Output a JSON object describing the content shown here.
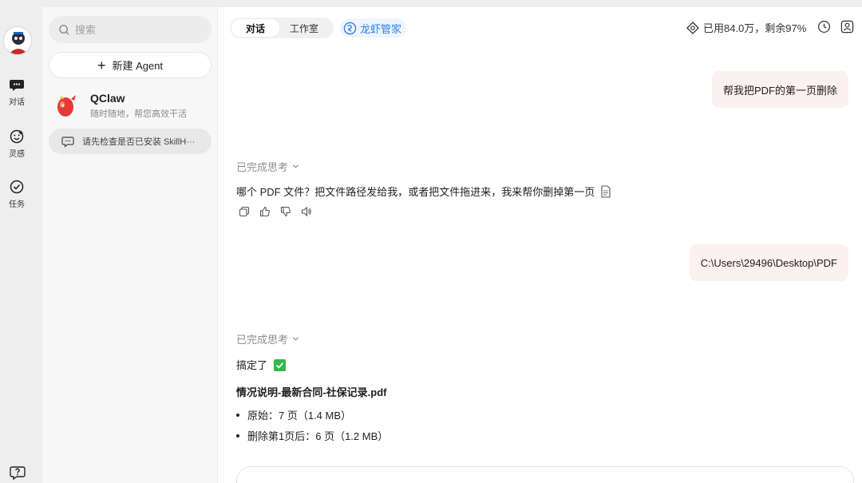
{
  "rail": {
    "items": [
      {
        "label": "对话",
        "icon": "chat-bubble-icon"
      },
      {
        "label": "灵感",
        "icon": "smiley-icon"
      },
      {
        "label": "任务",
        "icon": "check-circle-icon"
      }
    ],
    "help_icon": "help-icon"
  },
  "panel": {
    "search_placeholder": "搜索",
    "new_agent_label": "新建 Agent",
    "agent": {
      "name": "QClaw",
      "description": "随时随地，帮您高效干活"
    },
    "conversation": {
      "title": "请先检查是否已安装 SkillH···"
    }
  },
  "header": {
    "tabs": [
      {
        "label": "对话",
        "active": true
      },
      {
        "label": "工作室",
        "active": false
      }
    ],
    "brand_label": "龙虾管家",
    "quota_text": "已用84.0万，剩余97%"
  },
  "messages": {
    "user1": "帮我把PDF的第一页删除",
    "thinking_label": "已完成思考",
    "assistant1": "哪个 PDF 文件？把文件路径发给我，或者把文件拖进来，我来帮你删掉第一页",
    "user2": "C:\\Users\\29496\\Desktop\\PDF",
    "assistant2_intro": "搞定了",
    "file_name": "情况说明-最新合同-社保记录.pdf",
    "bullets": [
      "原始：7 页（1.4 MB）",
      "删除第1页后：6 页（1.2 MB）"
    ]
  },
  "colors": {
    "accent_blue": "#2f7fe0",
    "user_bubble": "#fdf0f0",
    "check_green": "#35b74a"
  }
}
